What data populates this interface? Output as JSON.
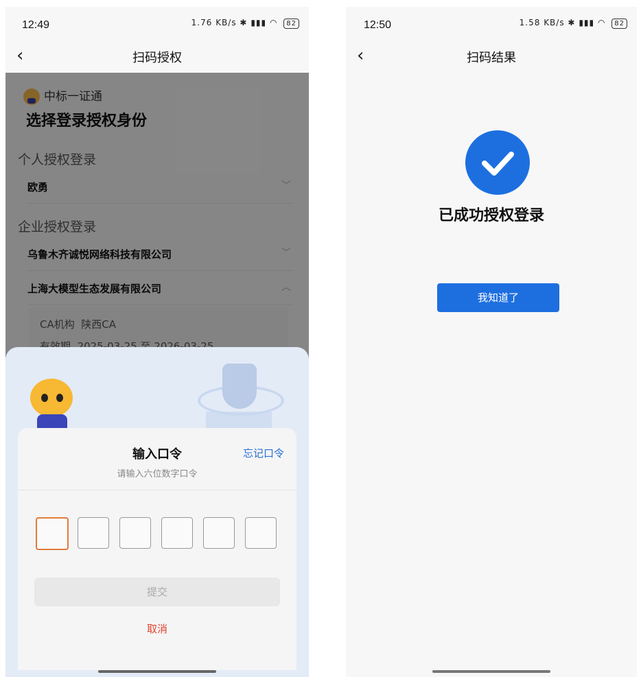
{
  "left": {
    "status": {
      "time": "12:49",
      "net_speed": "1.76 KB/s",
      "battery": "82"
    },
    "nav": {
      "title": "扫码授权"
    },
    "brand": "中标一证通",
    "heading": "选择登录授权身份",
    "personal_section": "个人授权登录",
    "personal_name": "欧勇",
    "enterprise_section": "企业授权登录",
    "companies": [
      "乌鲁木齐诚悦网络科技有限公司",
      "上海大模型生态发展有限公司"
    ],
    "ca_label": "CA机构",
    "ca_value": "陕西CA",
    "validity_label": "有效期",
    "validity_value": "2025-03-25 至 2026-03-25",
    "sheet": {
      "title": "输入口令",
      "subtitle": "请输入六位数字口令",
      "forgot": "忘记口令",
      "submit": "提交",
      "cancel": "取消"
    }
  },
  "right": {
    "status": {
      "time": "12:50",
      "net_speed": "1.58 KB/s",
      "battery": "82"
    },
    "nav": {
      "title": "扫码结果"
    },
    "result": "已成功授权登录",
    "button": "我知道了"
  },
  "colors": {
    "accent": "#1d6fe0",
    "cancel": "#e0442f",
    "active_box": "#e37a3a"
  }
}
